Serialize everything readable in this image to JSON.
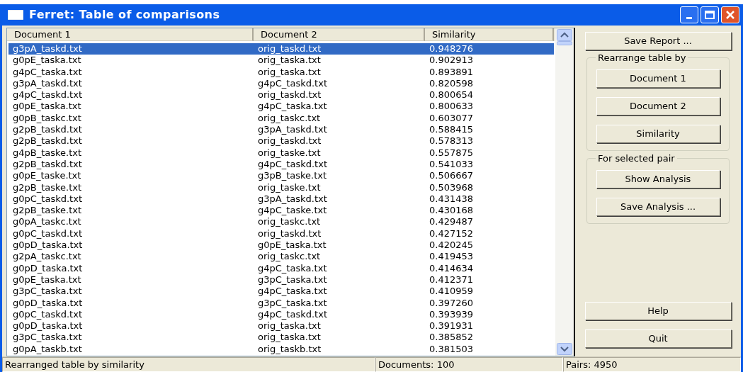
{
  "window": {
    "title": "Ferret: Table of comparisons"
  },
  "table": {
    "columns": [
      "Document 1",
      "Document 2",
      "Similarity"
    ],
    "rows": [
      {
        "document_1": "g3pA_taskd.txt",
        "document_2": "orig_taskd.txt",
        "similarity": "0.948276",
        "selected": true
      },
      {
        "document_1": "g0pE_taska.txt",
        "document_2": "orig_taska.txt",
        "similarity": "0.902913",
        "selected": false
      },
      {
        "document_1": "g4pC_taska.txt",
        "document_2": "orig_taska.txt",
        "similarity": "0.893891",
        "selected": false
      },
      {
        "document_1": "g3pA_taskd.txt",
        "document_2": "g4pC_taskd.txt",
        "similarity": "0.820598",
        "selected": false
      },
      {
        "document_1": "g4pC_taskd.txt",
        "document_2": "orig_taskd.txt",
        "similarity": "0.800654",
        "selected": false
      },
      {
        "document_1": "g0pE_taska.txt",
        "document_2": "g4pC_taska.txt",
        "similarity": "0.800633",
        "selected": false
      },
      {
        "document_1": "g0pB_taskc.txt",
        "document_2": "orig_taskc.txt",
        "similarity": "0.603077",
        "selected": false
      },
      {
        "document_1": "g2pB_taskd.txt",
        "document_2": "g3pA_taskd.txt",
        "similarity": "0.588415",
        "selected": false
      },
      {
        "document_1": "g2pB_taskd.txt",
        "document_2": "orig_taskd.txt",
        "similarity": "0.578313",
        "selected": false
      },
      {
        "document_1": "g4pB_taske.txt",
        "document_2": "orig_taske.txt",
        "similarity": "0.557875",
        "selected": false
      },
      {
        "document_1": "g2pB_taskd.txt",
        "document_2": "g4pC_taskd.txt",
        "similarity": "0.541033",
        "selected": false
      },
      {
        "document_1": "g0pE_taske.txt",
        "document_2": "g3pB_taske.txt",
        "similarity": "0.506667",
        "selected": false
      },
      {
        "document_1": "g2pB_taske.txt",
        "document_2": "orig_taske.txt",
        "similarity": "0.503968",
        "selected": false
      },
      {
        "document_1": "g0pC_taskd.txt",
        "document_2": "g3pA_taskd.txt",
        "similarity": "0.431438",
        "selected": false
      },
      {
        "document_1": "g2pB_taske.txt",
        "document_2": "g4pC_taske.txt",
        "similarity": "0.430168",
        "selected": false
      },
      {
        "document_1": "g0pA_taskc.txt",
        "document_2": "orig_taskc.txt",
        "similarity": "0.429487",
        "selected": false
      },
      {
        "document_1": "g0pC_taskd.txt",
        "document_2": "orig_taskd.txt",
        "similarity": "0.427152",
        "selected": false
      },
      {
        "document_1": "g0pD_taska.txt",
        "document_2": "g0pE_taska.txt",
        "similarity": "0.420245",
        "selected": false
      },
      {
        "document_1": "g2pA_taskc.txt",
        "document_2": "orig_taskc.txt",
        "similarity": "0.419453",
        "selected": false
      },
      {
        "document_1": "g0pD_taska.txt",
        "document_2": "g4pC_taska.txt",
        "similarity": "0.414634",
        "selected": false
      },
      {
        "document_1": "g0pE_taska.txt",
        "document_2": "g3pC_taska.txt",
        "similarity": "0.412371",
        "selected": false
      },
      {
        "document_1": "g3pC_taska.txt",
        "document_2": "g4pC_taska.txt",
        "similarity": "0.410959",
        "selected": false
      },
      {
        "document_1": "g0pD_taska.txt",
        "document_2": "g3pC_taska.txt",
        "similarity": "0.397260",
        "selected": false
      },
      {
        "document_1": "g0pC_taskd.txt",
        "document_2": "g4pC_taskd.txt",
        "similarity": "0.393939",
        "selected": false
      },
      {
        "document_1": "g0pD_taska.txt",
        "document_2": "orig_taska.txt",
        "similarity": "0.391931",
        "selected": false
      },
      {
        "document_1": "g3pC_taska.txt",
        "document_2": "orig_taska.txt",
        "similarity": "0.385852",
        "selected": false
      },
      {
        "document_1": "g0pA_taskb.txt",
        "document_2": "orig_taskb.txt",
        "similarity": "0.381503",
        "selected": false
      }
    ]
  },
  "save_report_button": "Save Report ...",
  "rearrange_group": {
    "title": "Rearrange table by",
    "buttons": [
      "Document 1",
      "Document 2",
      "Similarity"
    ]
  },
  "selected_pair_group": {
    "title": "For selected pair",
    "buttons": [
      "Show Analysis",
      "Save Analysis ..."
    ]
  },
  "bottom_buttons": [
    "Help",
    "Quit"
  ],
  "status_bar": [
    "Rearranged table by similarity",
    "Documents: 100",
    "Pairs: 4950"
  ]
}
